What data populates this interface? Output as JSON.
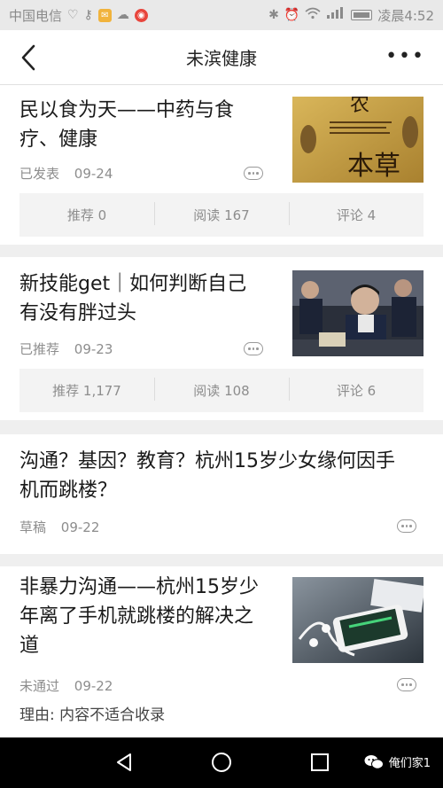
{
  "status_bar": {
    "carrier": "中国电信",
    "time": "凌晨4:52"
  },
  "nav": {
    "title": "未滨健康"
  },
  "articles": [
    {
      "title_line1": "民以食为天——中药与食",
      "title_line2": "疗、健康",
      "status": "已发表",
      "date": "09-24",
      "thumb": "herbal-book-image",
      "stats": {
        "recommend": "推荐 0",
        "read": "阅读 167",
        "comment": "评论 4"
      }
    },
    {
      "title_line1": "新技能get｜如何判断自己",
      "title_line2": "有没有胖过头",
      "status": "已推荐",
      "date": "09-23",
      "thumb": "students-classroom-image",
      "stats": {
        "recommend": "推荐 1,177",
        "read": "阅读 108",
        "comment": "评论 6"
      }
    },
    {
      "title_line1": "沟通？基因？教育？杭州15岁少女缘何因手",
      "title_line2": "机而跳楼？",
      "status": "草稿",
      "date": "09-22"
    },
    {
      "title_line1": "非暴力沟通——杭州15岁少",
      "title_line2": "年离了手机就跳楼的解决之",
      "title_line3": "道",
      "status": "未通过",
      "date": "09-22",
      "thumb": "phone-earphones-image",
      "reason": "理由: 内容不适合收录"
    }
  ],
  "watermark": {
    "text": "俺们家1"
  },
  "colors": {
    "background": "#efefef",
    "card": "#ffffff",
    "meta_text": "#8d8d8d",
    "stats_bg": "#f3f3f3",
    "system_nav": "#000000"
  }
}
